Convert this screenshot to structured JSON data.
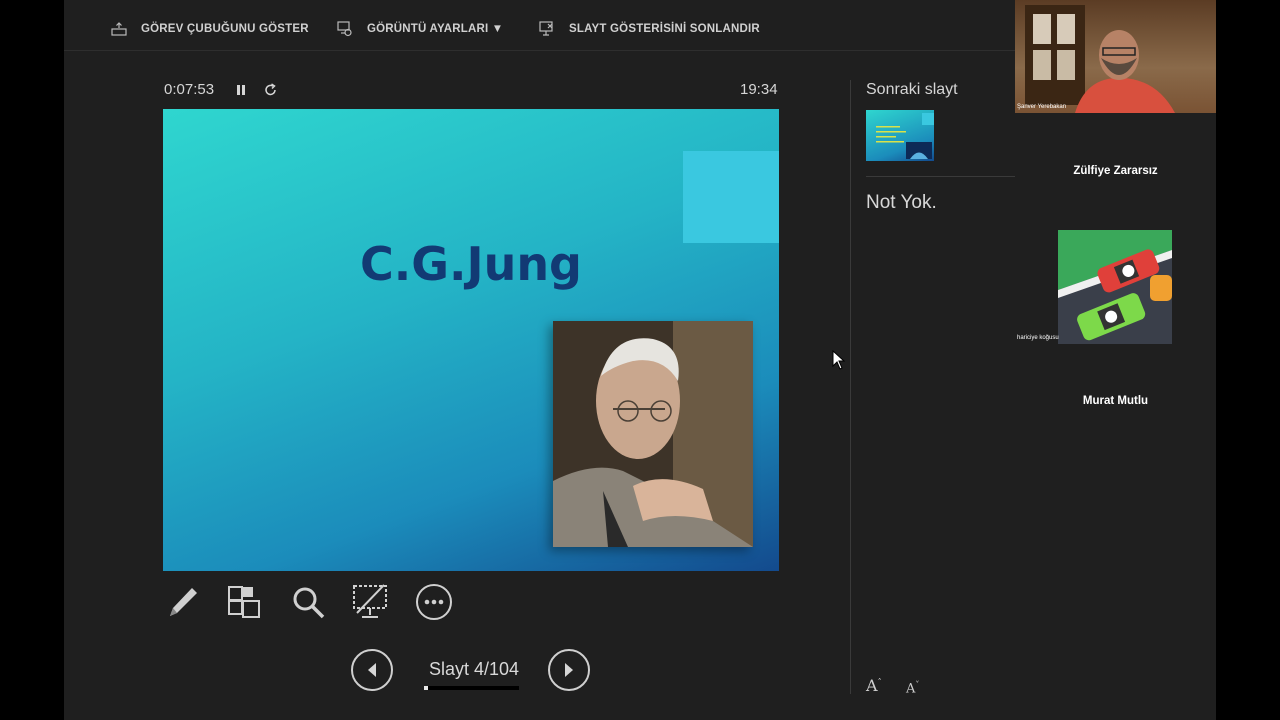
{
  "toolbar": {
    "show_taskbar": "GÖREV ÇUBUĞUNU GÖSTER",
    "display_settings": "GÖRÜNTÜ AYARLARI ▼",
    "end_slideshow": "SLAYT GÖSTERİSİNİ SONLANDIR"
  },
  "presenter": {
    "elapsed": "0:07:53",
    "clock": "19:34",
    "slide_title": "C.G.Jung",
    "slide_counter": "Slayt 4/104",
    "progress": 0.0385
  },
  "side": {
    "next_label": "Sonraki slayt",
    "notes": "Not Yok.",
    "font_increase": "A",
    "font_decrease": "A"
  },
  "participants": {
    "cam_name": "Şanver Yerebakan",
    "p1": "Zülfiye Zararsız",
    "avatar_label": "hariciye koğusu",
    "p2": "Murat Mutlu"
  },
  "icons": [
    "taskbar-icon",
    "display-settings-icon",
    "end-show-icon",
    "pause-icon",
    "reset-icon",
    "pen-icon",
    "slides-grid-icon",
    "zoom-icon",
    "black-screen-icon",
    "more-icon",
    "prev-arrow-icon",
    "next-arrow-icon",
    "cursor-icon"
  ]
}
